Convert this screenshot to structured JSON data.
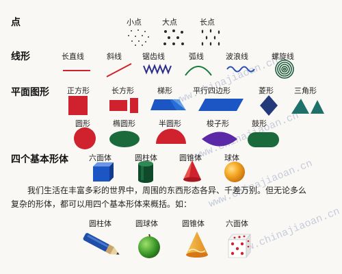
{
  "sections": {
    "points": {
      "heading": "点",
      "labels": [
        "小点",
        "大点",
        "长点"
      ]
    },
    "lines": {
      "heading": "线形",
      "labels": [
        "长直线",
        "斜线",
        "锯齿线",
        "弧线",
        "波浪线",
        "螺旋线"
      ]
    },
    "plane": {
      "heading": "平面图形",
      "row1": [
        "正方形",
        "长方形",
        "梯形",
        "平行四边形",
        "菱形",
        "三角形"
      ],
      "row2": [
        "圆形",
        "椭圆形",
        "半圆形",
        "梭子形",
        "鼓形"
      ]
    },
    "solids": {
      "heading": "四个基本形体",
      "labels": [
        "六面体",
        "圆柱体",
        "圆锥体",
        "球体"
      ]
    }
  },
  "paragraph": {
    "line1": "我们生活在丰富多彩的世界中，周围的东西形态各异、千差万别。但无论多么",
    "line2": "复杂的形体，都可以用四个基本形体来概括。如："
  },
  "examples": {
    "labels": [
      "圆柱体",
      "圆球体",
      "圆锥体",
      "六面体"
    ]
  },
  "watermark": "www.chinajiaoan.cn",
  "colors": {
    "red": "#d0222e",
    "blue": "#1c55c4",
    "green": "#1a6a3c",
    "purple": "#5b28a8",
    "navy": "#233a7a",
    "teal": "#1f6f6a",
    "orange": "#f29a1a"
  }
}
